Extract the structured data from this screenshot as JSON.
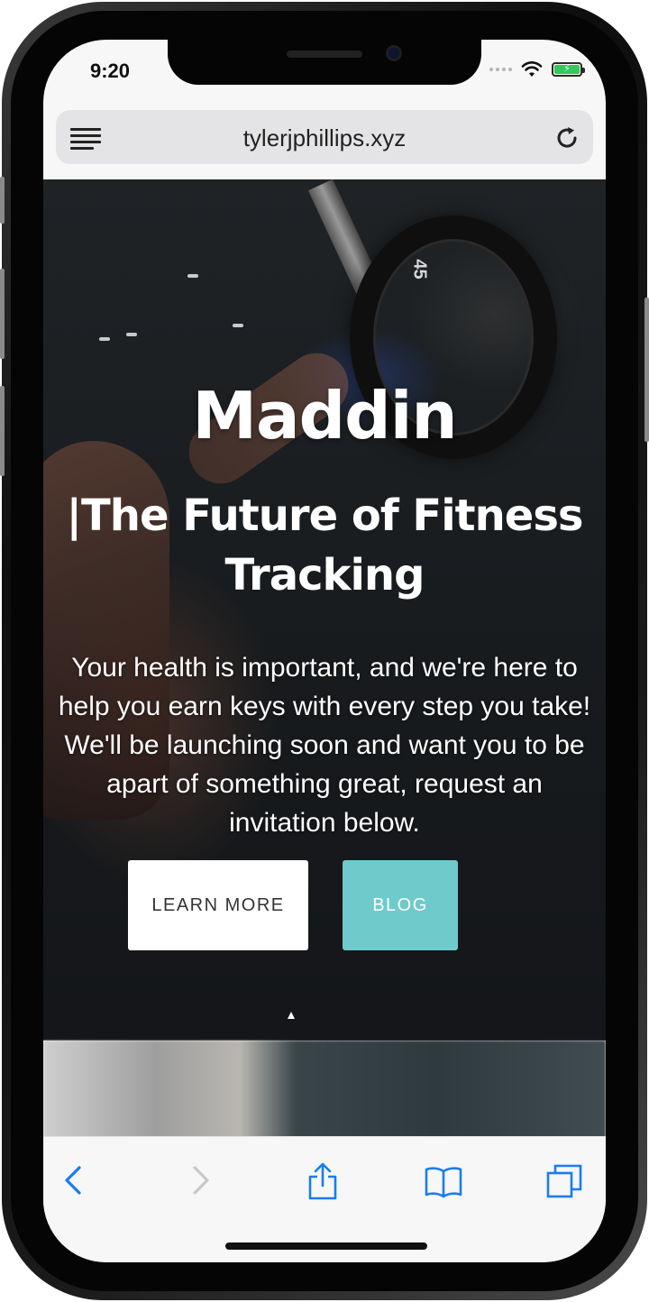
{
  "status_bar": {
    "time": "9:20"
  },
  "browser": {
    "url": "tylerjphillips.xyz"
  },
  "hero": {
    "title": "Maddin",
    "subtitle_line1": "|The Future of Fitness",
    "subtitle_line2": "Tracking",
    "description": "Your health is important, and we're here to help you earn keys with every step you take! We'll be launching soon and want you to be apart of something great, request an invitation below.",
    "plate_number": "45",
    "buttons": {
      "learn_more": "LEARN MORE",
      "blog": "BLOG"
    }
  },
  "toolbar": {
    "icons": [
      "back-icon",
      "forward-icon",
      "share-icon",
      "bookmarks-icon",
      "tabs-icon"
    ]
  },
  "colors": {
    "accent": "#6fcacb",
    "link_blue": "#1a7cf0",
    "battery_green": "#34c759"
  }
}
